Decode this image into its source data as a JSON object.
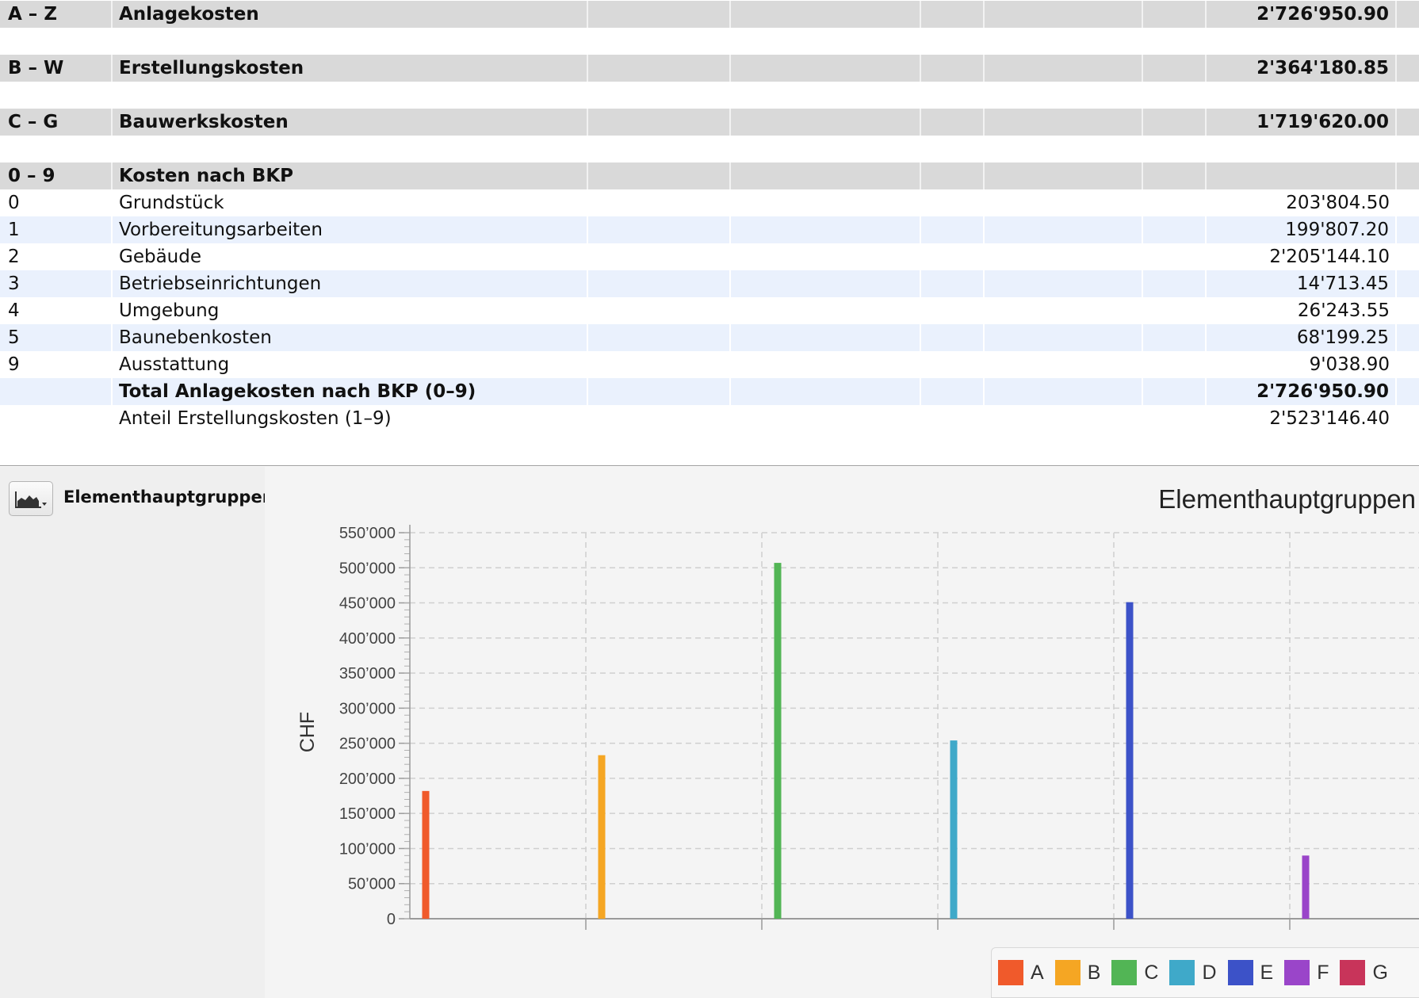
{
  "table": {
    "rows": [
      {
        "kind": "group",
        "code": "A – Z",
        "name": "Anlagekosten",
        "value": "2'726'950.90"
      },
      {
        "kind": "blank"
      },
      {
        "kind": "group",
        "code": "B – W",
        "name": "Erstellungskosten",
        "value": "2'364'180.85"
      },
      {
        "kind": "blank"
      },
      {
        "kind": "group",
        "code": "C – G",
        "name": "Bauwerkskosten",
        "value": "1'719'620.00"
      },
      {
        "kind": "blank"
      },
      {
        "kind": "group",
        "code": "0 – 9",
        "name": "Kosten nach BKP",
        "value": ""
      },
      {
        "kind": "plain",
        "code": "0",
        "name": "Grundstück",
        "value": "203'804.50"
      },
      {
        "kind": "alt",
        "code": "1",
        "name": "Vorbereitungsarbeiten",
        "value": "199'807.20"
      },
      {
        "kind": "plain",
        "code": "2",
        "name": "Gebäude",
        "value": "2'205'144.10"
      },
      {
        "kind": "alt",
        "code": "3",
        "name": "Betriebseinrichtungen",
        "value": "14'713.45"
      },
      {
        "kind": "plain",
        "code": "4",
        "name": "Umgebung",
        "value": "26'243.55"
      },
      {
        "kind": "alt",
        "code": "5",
        "name": "Baunebenkosten",
        "value": "68'199.25"
      },
      {
        "kind": "plain",
        "code": "9",
        "name": "Ausstattung",
        "value": "9'038.90"
      },
      {
        "kind": "alt-bold",
        "code": "",
        "name": "Total Anlagekosten nach BKP (0–9)",
        "value": "2'726'950.90"
      },
      {
        "kind": "plain",
        "code": "",
        "name": "Anteil Erstellungskosten (1–9)",
        "value": "2'523'146.40"
      }
    ]
  },
  "side_panel": {
    "chart_type_icon": "area-chart-icon",
    "title": "Elementhauptgruppen"
  },
  "chart_data": {
    "type": "bar",
    "title": "Elementhauptgruppen",
    "xlabel": "",
    "ylabel": "CHF",
    "ylim": [
      0,
      550000
    ],
    "ytick_step": 50000,
    "ytick_labels": [
      "0",
      "50’000",
      "100’000",
      "150’000",
      "200’000",
      "250’000",
      "300’000",
      "350’000",
      "400’000",
      "450’000",
      "500’000",
      "550’000"
    ],
    "grid": true,
    "legend_position": "bottom-right",
    "categories": [
      "A",
      "B",
      "C",
      "D",
      "E",
      "F",
      "G"
    ],
    "values": [
      182000,
      233000,
      507000,
      254000,
      451000,
      90000,
      0
    ],
    "colors": [
      "#f05a2b",
      "#f5a623",
      "#52b555",
      "#3fa9c9",
      "#3c52c8",
      "#9a45c9",
      "#c8345a"
    ]
  }
}
